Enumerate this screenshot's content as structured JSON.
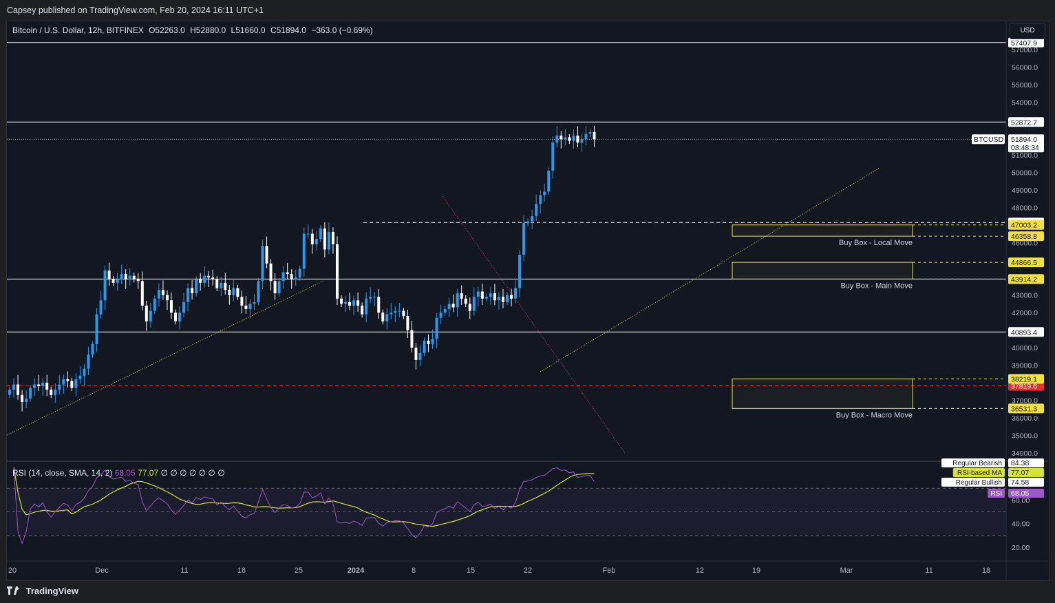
{
  "header": {
    "published_by": "Capsey published on TradingView.com, Feb 20, 2024 16:11 UTC+1"
  },
  "legend": {
    "symbol": "Bitcoin / U.S. Dollar, 12h, BITFINEX",
    "open": "O52263.0",
    "high": "H52880.0",
    "low": "L51660.0",
    "close": "C51894.0",
    "change": "−363.0 (−0.69%)"
  },
  "currency_button": "USD",
  "rsi_legend": {
    "label": "RSI (14, close, SMA, 14, 2)",
    "rsi_value": "68.05",
    "ma_value": "77.07",
    "placeholders": "∅ ∅ ∅ ∅ ∅ ∅ ∅"
  },
  "footer": {
    "brand": "TradingView"
  },
  "colors": {
    "up": "#2f96e8",
    "down": "#ffffff",
    "background": "#131722",
    "grid": "#2a2e39",
    "rsi_line": "#9c58c6",
    "rsi_ma": "#d5e335",
    "buy_box": "#f0e040",
    "red_line": "#e03030"
  },
  "chart_data": {
    "type": "candlestick",
    "interval": "12h",
    "ylim": [
      33600,
      58500
    ],
    "price_ticks": [
      34000,
      35000,
      36000,
      37000,
      38000,
      39000,
      40000,
      41000,
      42000,
      43000,
      44000,
      45000,
      46000,
      47000,
      48000,
      49000,
      50000,
      51000,
      52000,
      53000,
      54000,
      55000,
      56000,
      57000
    ],
    "x_ticks": [
      "20",
      "Dec",
      "11",
      "18",
      "25",
      "2024",
      "8",
      "15",
      "22",
      "Feb",
      "12",
      "19",
      "Mar",
      "11",
      "18"
    ],
    "closes": [
      37600,
      37900,
      37300,
      36900,
      37100,
      37700,
      37900,
      37800,
      38000,
      37600,
      37300,
      37600,
      37900,
      38200,
      38100,
      37700,
      38200,
      38400,
      38800,
      39600,
      40200,
      41900,
      42700,
      44400,
      43900,
      43700,
      43900,
      44200,
      43900,
      44100,
      43900,
      43800,
      42400,
      41500,
      42100,
      42800,
      43300,
      43000,
      42700,
      42000,
      41500,
      42000,
      42600,
      43400,
      43100,
      43900,
      43700,
      44100,
      44000,
      43900,
      43400,
      43700,
      43300,
      43000,
      43400,
      42900,
      42400,
      42200,
      42500,
      42600,
      43800,
      45800,
      44800,
      43800,
      43100,
      43800,
      44300,
      44200,
      43900,
      44000,
      44500,
      46500,
      46500,
      45900,
      46200,
      46800,
      45600,
      46600,
      45900,
      42800,
      42500,
      42600,
      42400,
      42700,
      42400,
      41900,
      42800,
      42900,
      42900,
      42000,
      41500,
      41900,
      42000,
      42100,
      42100,
      41800,
      41000,
      40000,
      39300,
      39700,
      40400,
      40200,
      40500,
      41700,
      42000,
      42200,
      42500,
      42300,
      43100,
      42800,
      42500,
      42100,
      42900,
      43200,
      42800,
      42900,
      43100,
      42700,
      42900,
      42600,
      43000,
      42800,
      43400,
      45300,
      47100,
      47200,
      47500,
      48200,
      48700,
      48900,
      50100,
      51700,
      52100,
      51900,
      52000,
      51800,
      52100,
      51700,
      51900,
      52200,
      52300,
      51894
    ],
    "price_lines": [
      {
        "label": "57407.9",
        "price": 57407.9,
        "style": "solid",
        "color": "#ffffff"
      },
      {
        "label": "52872.7",
        "price": 52872.7,
        "style": "solid",
        "color": "#ffffff"
      },
      {
        "label": "47138.3",
        "price": 47138.3,
        "style": "dashed",
        "color": "#ffffff"
      },
      {
        "label": "43915.6",
        "price": 43915.6,
        "style": "solid",
        "color": "#ffffff"
      },
      {
        "label": "40893.4",
        "price": 40893.4,
        "style": "solid",
        "color": "#ffffff"
      },
      {
        "label": "37819.6",
        "price": 37819.6,
        "style": "dashed",
        "color": "#e03030"
      }
    ],
    "yellow_labels": [
      {
        "label": "47003.2",
        "price": 47003.2
      },
      {
        "label": "46358.8",
        "price": 46358.8
      },
      {
        "label": "44866.5",
        "price": 44866.5
      },
      {
        "label": "43914.2",
        "price": 43914.2
      },
      {
        "label": "38219.1",
        "price": 38219.1
      },
      {
        "label": "36531.3",
        "price": 36531.3
      }
    ],
    "buy_boxes": [
      {
        "label": "Buy Box - Local Move",
        "top": 47003.2,
        "bottom": 46358.8
      },
      {
        "label": "Buy Box - Main Move",
        "top": 44866.5,
        "bottom": 43914.2
      },
      {
        "label": "Buy Box - Macro Move",
        "top": 38219.1,
        "bottom": 36531.3
      }
    ],
    "current_price": {
      "symbol": "BTCUSD",
      "value": "51894.0",
      "countdown": "08:48:34"
    },
    "rsi": {
      "ticks": [
        "60.00",
        "40.00",
        "20.00"
      ],
      "levels": [
        70,
        50,
        30
      ],
      "ylim": [
        10,
        90
      ],
      "rsi_value": "68.05",
      "ma_value": "77.07",
      "labels": [
        {
          "text": "Regular Bearish",
          "value": "84.38"
        },
        {
          "text": "RSI-based MA",
          "value": "77.07"
        },
        {
          "text": "Regular Bullish",
          "value": "74.58"
        },
        {
          "text": "RSI",
          "value": "68.05"
        }
      ]
    }
  }
}
